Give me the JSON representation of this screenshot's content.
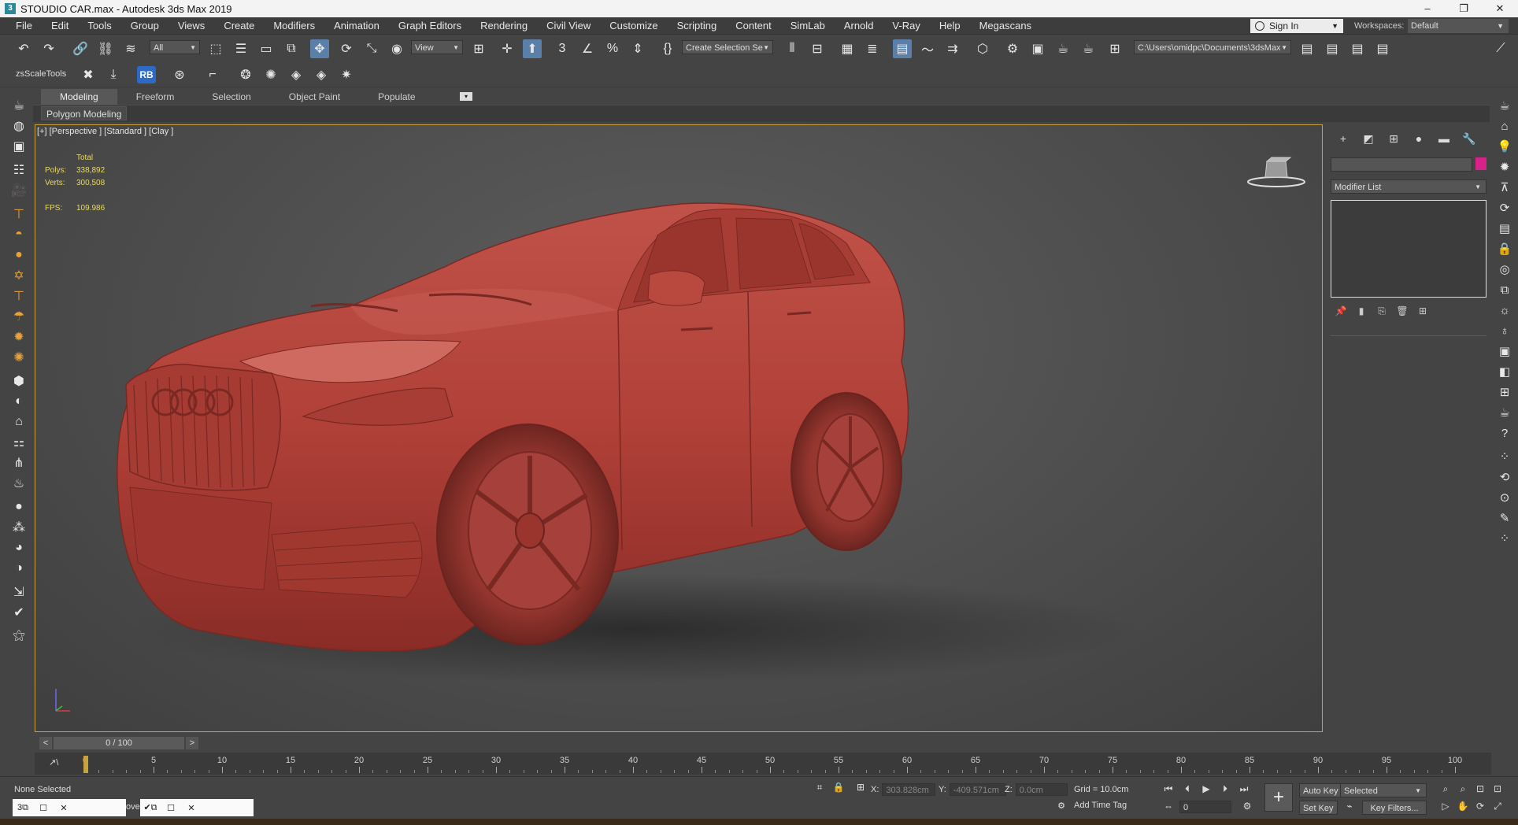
{
  "titlebar": {
    "app_icon": "3",
    "title": "STOUDIO  CAR.max - Autodesk 3ds Max 2019",
    "minimize": "–",
    "restore": "❐",
    "close": "✕"
  },
  "menu": {
    "items": [
      "File",
      "Edit",
      "Tools",
      "Group",
      "Views",
      "Create",
      "Modifiers",
      "Animation",
      "Graph Editors",
      "Rendering",
      "Civil View",
      "Customize",
      "Scripting",
      "Content",
      "SimLab",
      "Arnold",
      "V-Ray",
      "Help",
      "Megascans"
    ]
  },
  "account": {
    "sign_in": "Sign In",
    "workspaces_label": "Workspaces:",
    "workspace_value": "Default"
  },
  "toolbar": {
    "selection_filter": "All",
    "ref_coord": "View",
    "create_selection_set": "Create Selection Se",
    "project_path": "C:\\Users\\omidpc\\Documents\\3dsMax",
    "zs_label": "zsScaleTools",
    "rb_label": "RB"
  },
  "ribbon": {
    "tabs": [
      "Modeling",
      "Freeform",
      "Selection",
      "Object Paint",
      "Populate"
    ],
    "active_tab": "Modeling",
    "panel_label": "Polygon Modeling"
  },
  "viewport": {
    "label": "[+] [Perspective ] [Standard ] [Clay ]",
    "stats": {
      "total_label": "Total",
      "polys_label": "Polys:",
      "polys_value": "338,892",
      "verts_label": "Verts:",
      "verts_value": "300,508",
      "fps_label": "FPS:",
      "fps_value": "109.986"
    },
    "clay_color": "#b5443a"
  },
  "command_panel": {
    "modifier_list": "Modifier List",
    "object_color": "#d7228a"
  },
  "timeslider": {
    "prev": "<",
    "position": "0 / 100",
    "next": ">"
  },
  "trackbar": {
    "ticks": [
      "0",
      "5",
      "10",
      "15",
      "20",
      "25",
      "30",
      "35",
      "40",
      "45",
      "50",
      "55",
      "60",
      "65",
      "70",
      "75",
      "80",
      "85",
      "90",
      "95",
      "100"
    ]
  },
  "status": {
    "selection": "None Selected",
    "x_label": "X:",
    "x_value": "303.828cm",
    "y_label": "Y:",
    "y_value": "-409.571cm",
    "z_label": "Z:",
    "z_value": "0.0cm",
    "grid": "Grid = 10.0cm",
    "add_time_tag": "Add Time Tag",
    "auto_key": "Auto Key",
    "set_key": "Set Key",
    "key_mode": "Selected",
    "key_filters": "Key Filters...",
    "current_frame": "0",
    "taskbar_fragment": "ove"
  }
}
